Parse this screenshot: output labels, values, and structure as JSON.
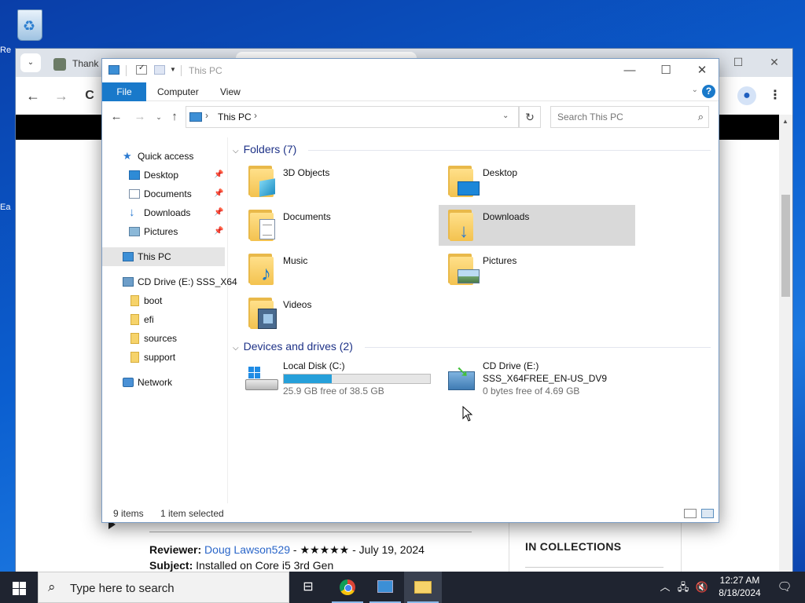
{
  "desktop": {
    "clip_label_1": "Re",
    "clip_label_2": "Ea"
  },
  "browser": {
    "tab_title": "Thank Y",
    "nav": {
      "back": "←",
      "forward": "→",
      "reload": "C"
    },
    "review": {
      "reviewer_label": "Reviewer:",
      "reviewer_name": "Doug Lawson529",
      "reviewer_meta": "- ★★★★★ - July 19, 2024",
      "subject_label": "Subject:",
      "subject_text": "Installed on Core i5 3rd Gen"
    },
    "collections_title": "IN COLLECTIONS"
  },
  "explorer": {
    "title": "This PC",
    "ribbon": {
      "file": "File",
      "computer": "Computer",
      "view": "View",
      "help": "?"
    },
    "address": {
      "crumb": "This PC"
    },
    "search": {
      "placeholder": "Search This PC"
    },
    "nav_pane": {
      "quick_access": "Quick access",
      "items": [
        {
          "label": "Desktop"
        },
        {
          "label": "Documents"
        },
        {
          "label": "Downloads"
        },
        {
          "label": "Pictures"
        }
      ],
      "this_pc": "This PC",
      "cd_drive": "CD Drive (E:) SSS_X64",
      "cd_children": [
        "boot",
        "efi",
        "sources",
        "support"
      ],
      "network": "Network"
    },
    "folders_header": "Folders (7)",
    "folders": [
      {
        "name": "3D Objects",
        "icon": "3d-objects-icon"
      },
      {
        "name": "Desktop",
        "icon": "desktop-icon"
      },
      {
        "name": "Documents",
        "icon": "documents-icon"
      },
      {
        "name": "Downloads",
        "icon": "downloads-icon",
        "selected": true
      },
      {
        "name": "Music",
        "icon": "music-icon"
      },
      {
        "name": "Pictures",
        "icon": "pictures-icon"
      },
      {
        "name": "Videos",
        "icon": "videos-icon"
      }
    ],
    "drives_header": "Devices and drives (2)",
    "drives": [
      {
        "name": "Local Disk (C:)",
        "free": "25.9 GB free of 38.5 GB",
        "used_fraction": 0.33
      },
      {
        "name": "CD Drive (E:)",
        "label": "SSS_X64FREE_EN-US_DV9",
        "free": "0 bytes free of 4.69 GB"
      }
    ],
    "status": {
      "items": "9 items",
      "selected": "1 item selected"
    }
  },
  "taskbar": {
    "search_placeholder": "Type here to search",
    "time": "12:27 AM",
    "date": "8/18/2024"
  }
}
